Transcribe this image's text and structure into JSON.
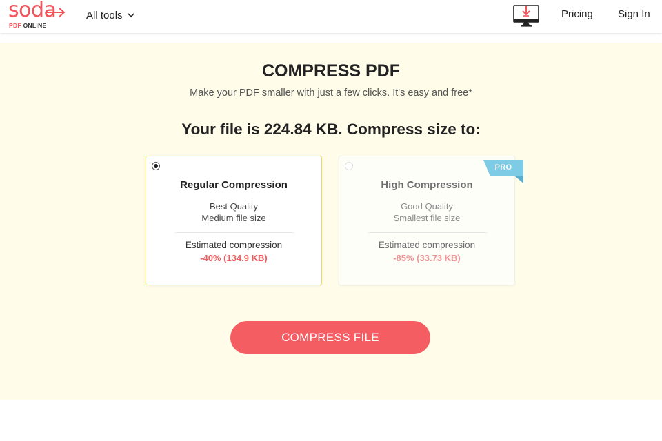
{
  "header": {
    "logo": {
      "word": "soda",
      "sub_pdf": "PDF",
      "sub_online": "ONLINE"
    },
    "all_tools_label": "All tools",
    "desktop_icon": "desktop-download-icon",
    "pricing_label": "Pricing",
    "signin_label": "Sign In"
  },
  "main": {
    "title": "COMPRESS PDF",
    "subtitle": "Make your PDF smaller with just a few clicks. It's easy and free*",
    "question": "Your file is 224.84 KB. Compress size to:",
    "options": [
      {
        "title": "Regular Compression",
        "line1": "Best Quality",
        "line2": "Medium file size",
        "estimate_label": "Estimated compression",
        "estimate_value": "-40% (134.9 KB)",
        "selected": true
      },
      {
        "title": "High Compression",
        "line1": "Good Quality",
        "line2": "Smallest file size",
        "estimate_label": "Estimated compression",
        "estimate_value": "-85% (33.73 KB)",
        "selected": false,
        "badge": "PRO"
      }
    ],
    "compress_button": "COMPRESS FILE"
  },
  "colors": {
    "brand_red": "#f2545b",
    "band_background": "#fffcea",
    "selected_border": "#f0d563",
    "pro_badge": "#7ecbe6",
    "button": "#f45d62"
  }
}
